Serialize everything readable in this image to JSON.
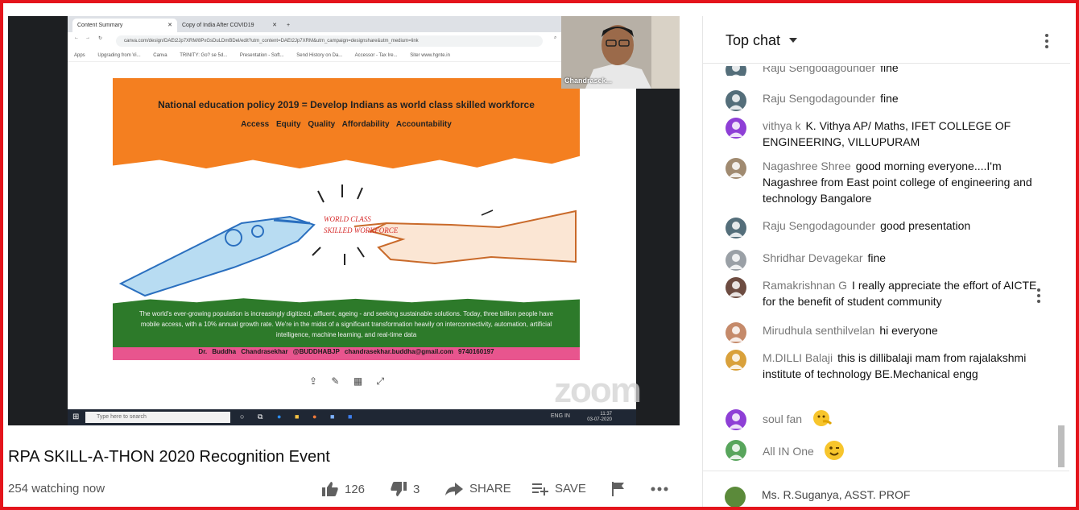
{
  "browser": {
    "tab1": "Content Summary",
    "tab2": "Copy of India After COVID19",
    "url": "canva.com/design/DAEt2Jp7XRM/8PxGsDuLDmBDel/edit?utm_content=DAEt2Jp7XRM&utm_campaign=designshare&utm_medium=link",
    "bookmarks": [
      "Apps",
      "Upgrading from Vi...",
      "Canva",
      "TRINITY: Go? se 5d...",
      "Presentation - Soft...",
      "Send History on Da...",
      "Accessor - Tax Ire...",
      "Siter www.hgnte.in"
    ]
  },
  "slide": {
    "title": "National education policy 2019 = Develop Indians as world class skilled workforce",
    "subtitle": "Access  Equity  Quality  Affordability  Accountability",
    "art_label_1": "WORLD CLASS",
    "art_label_2": "SKILLED WORKFORCE",
    "body": "The world's ever-growing population is increasingly digitized, affluent, ageing - and seeking sustainable solutions. Today, three billion people have mobile access, with a 10% annual growth rate. We're in the midst of a significant transformation heavily on interconnectivity, automation, artificial intelligence, machine learning, and real-time data",
    "author": "Dr. Buddha Chandrasekhar   @BUDDHABJP   chandrasekhar.buddha@gmail.com   9740160197"
  },
  "taskbar": {
    "search_placeholder": "Type here to search",
    "lang": "ENG IN",
    "time": "11:37",
    "date": "03-07-2020"
  },
  "zoom_watermark": "zoom",
  "camera": {
    "name": "Chandrasek..."
  },
  "video": {
    "title": "RPA SKILL-A-THON 2020 Recognition Event",
    "watching": "254 watching now",
    "likes": "126",
    "dislikes": "3",
    "share": "SHARE",
    "save": "SAVE"
  },
  "chat": {
    "title": "Top chat",
    "messages": [
      {
        "author": "Raju Sengodagounder",
        "text": "fine",
        "avatar_color": "#546e7a"
      },
      {
        "author": "Raju Sengodagounder",
        "text": "fine",
        "avatar_color": "#546e7a"
      },
      {
        "author": "vithya k",
        "text": "K. Vithya AP/ Maths, IFET COLLEGE OF ENGINEERING, VILLUPURAM",
        "avatar_color": "#8e3fd6"
      },
      {
        "author": "Nagashree Shree",
        "text": "good morning everyone....I'm Nagashree from East point college of engineering and technology Bangalore",
        "avatar_color": "#a08a70"
      },
      {
        "author": "Raju Sengodagounder",
        "text": "good presentation",
        "avatar_color": "#546e7a"
      },
      {
        "author": "Shridhar Devagekar",
        "text": "fine",
        "avatar_color": "#9aa0a6"
      },
      {
        "author": "Ramakrishnan G",
        "text": "I really appreciate the effort of AICTE for the benefit of student community",
        "avatar_color": "#6d4c41"
      },
      {
        "author": "Mirudhula senthilvelan",
        "text": "hi everyone",
        "avatar_color": "#c58a6a"
      },
      {
        "author": "M.DILLI Balaji",
        "text": "this is dillibalaji mam from rajalakshmi institute of technology BE.Mechanical engg",
        "avatar_color": "#d9a13b"
      },
      {
        "author": "soul fan",
        "text": "",
        "avatar_color": "#8e3fd6"
      },
      {
        "author": "All IN One",
        "text": "",
        "avatar_color": "#58a55c"
      }
    ],
    "pinned": {
      "author": "Ms. R.Suganya, ASST. PROF",
      "avatar_color": "#5b8a3a"
    }
  },
  "colors": {
    "frame": "#e4141b",
    "orange": "#f47f20",
    "green": "#2d7a2a",
    "pink": "#e8558e"
  }
}
